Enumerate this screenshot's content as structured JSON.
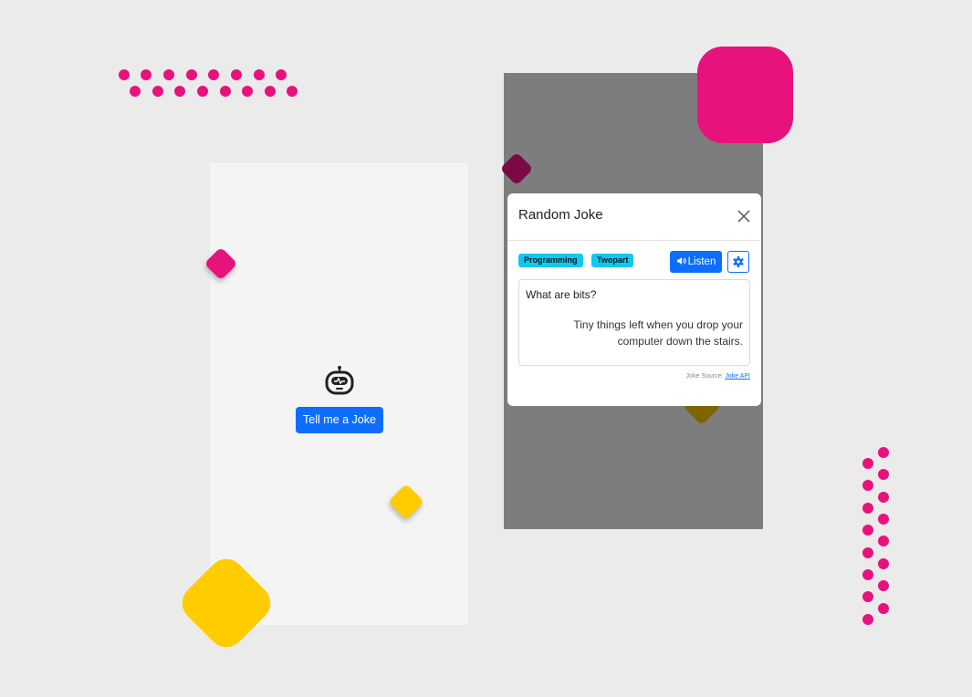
{
  "launcher": {
    "button_label": "Tell me a Joke",
    "icon": "robot-icon"
  },
  "modal": {
    "title": "Random Joke",
    "close_icon": "close-icon",
    "badges": [
      "Programming",
      "Twopart"
    ],
    "listen_label": "Listen",
    "listen_icon": "speaker-icon",
    "settings_icon": "gear-icon",
    "setup": "What are bits?",
    "delivery": "Tiny things left when you drop your computer down the stairs.",
    "source_label": "Joke Source:",
    "source_link": "Joke API"
  },
  "colors": {
    "accent": "#0d6efd",
    "badge": "#11c8f0",
    "pink": "#e8127c",
    "yellow": "#ffcc00"
  }
}
